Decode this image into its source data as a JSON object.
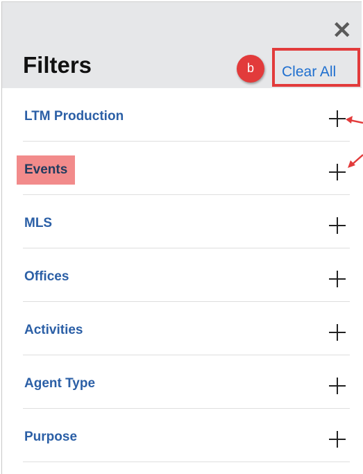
{
  "panel": {
    "title": "Filters",
    "close_icon": "close-icon",
    "close_glyph": "✕",
    "clear_all_label": "Clear All",
    "callout_badge": "b"
  },
  "filters": [
    {
      "label": "LTM Production",
      "icon": "plus-icon"
    },
    {
      "label": "Events",
      "icon": "plus-icon"
    },
    {
      "label": "MLS",
      "icon": "plus-icon"
    },
    {
      "label": "Offices",
      "icon": "plus-icon"
    },
    {
      "label": "Activities",
      "icon": "plus-icon"
    },
    {
      "label": "Agent Type",
      "icon": "plus-icon"
    },
    {
      "label": "Purpose",
      "icon": "plus-icon"
    }
  ],
  "colors": {
    "header_bg": "#e6e7e9",
    "link_blue": "#2b5fa6",
    "clear_all_blue": "#1f6fcf",
    "annotation_red": "#e23b3b",
    "highlight_pink": "#f28b8b"
  }
}
